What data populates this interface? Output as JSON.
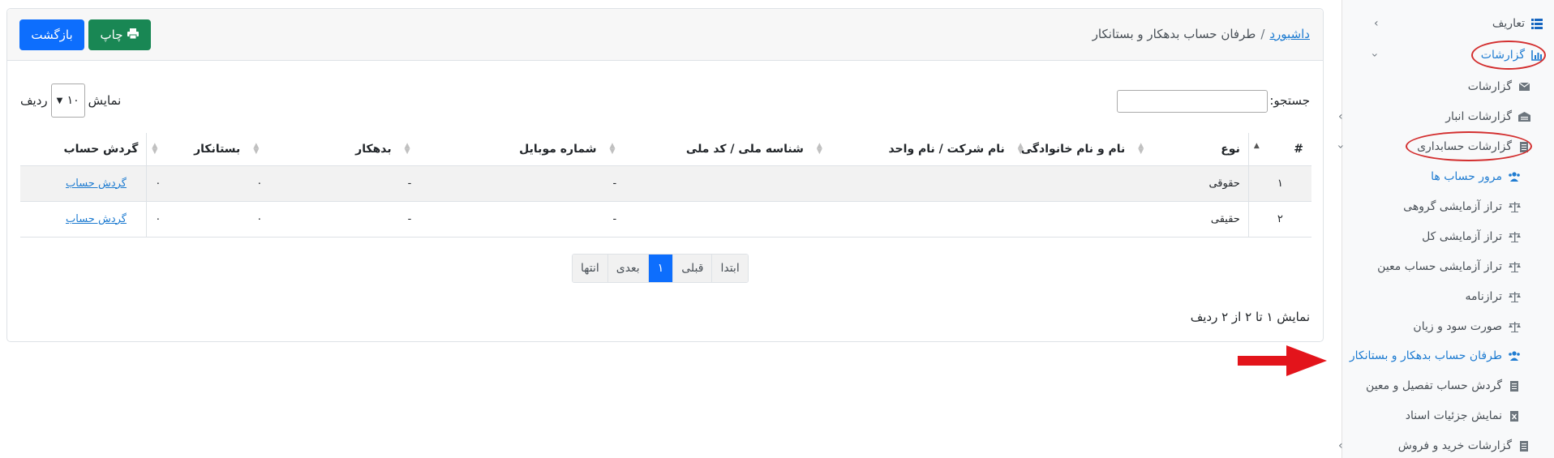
{
  "sidebar": {
    "items": [
      {
        "label": "تعاریف",
        "icon": "list-icon"
      },
      {
        "label": "گزارشات",
        "icon": "chart-icon"
      },
      {
        "label": "گزارشات",
        "icon": "envelope-icon"
      },
      {
        "label": "گزارشات انبار",
        "icon": "warehouse-icon"
      },
      {
        "label": "گزارشات حسابداری",
        "icon": "file-icon"
      },
      {
        "label": "مرور حساب ها",
        "icon": "users-icon"
      },
      {
        "label": "تراز آزمایشی گروهی",
        "icon": "balance-icon"
      },
      {
        "label": "تراز آزمایشی کل",
        "icon": "balance-icon"
      },
      {
        "label": "تراز آزمایشی حساب معین",
        "icon": "balance-icon"
      },
      {
        "label": "ترازنامه",
        "icon": "balance-icon"
      },
      {
        "label": "صورت سود و زیان",
        "icon": "balance-icon"
      },
      {
        "label": "طرفان حساب بدهکار و بستانکار",
        "icon": "users-icon"
      },
      {
        "label": "گردش حساب تفصیل و معین",
        "icon": "file-icon"
      },
      {
        "label": "نمایش جزئیات اسناد",
        "icon": "excel-file-icon"
      },
      {
        "label": "گزارشات خرید و فروش",
        "icon": "file-icon"
      }
    ]
  },
  "breadcrumb": {
    "home": "داشبورد",
    "separator": "/",
    "current": "طرفان حساب بدهکار و بستانکار"
  },
  "buttons": {
    "back": "بازگشت",
    "print": "چاپ"
  },
  "search": {
    "label": "جستجو:",
    "value": ""
  },
  "length": {
    "prefix": "نمایش",
    "value": "۱۰",
    "suffix": "ردیف"
  },
  "table": {
    "headers": [
      "#",
      "نوع",
      "نام و نام خانوادگی",
      "نام شرکت / نام واحد",
      "شناسه ملی / کد ملی",
      "شماره موبایل",
      "بدهکار",
      "بستانکار",
      "گردش حساب"
    ],
    "rows": [
      {
        "num": "۱",
        "type": "حقوقی",
        "name": "",
        "company": "",
        "national_id": "-",
        "mobile": "-",
        "debit": "۰",
        "credit": "۰",
        "link": "گردش حساب"
      },
      {
        "num": "۲",
        "type": "حقیقی",
        "name": "",
        "company": "",
        "national_id": "-",
        "mobile": "-",
        "debit": "۰",
        "credit": "۰",
        "link": "گردش حساب"
      }
    ]
  },
  "pagination": {
    "first": "ابتدا",
    "prev": "قبلی",
    "current": "۱",
    "next": "بعدی",
    "last": "انتها"
  },
  "info": "نمایش ۱ تا ۲ از ۲ ردیف",
  "colors": {
    "primary": "#0d6efd",
    "success": "#198754",
    "link": "#1f7cd1",
    "annotation": "#d32f2f"
  }
}
